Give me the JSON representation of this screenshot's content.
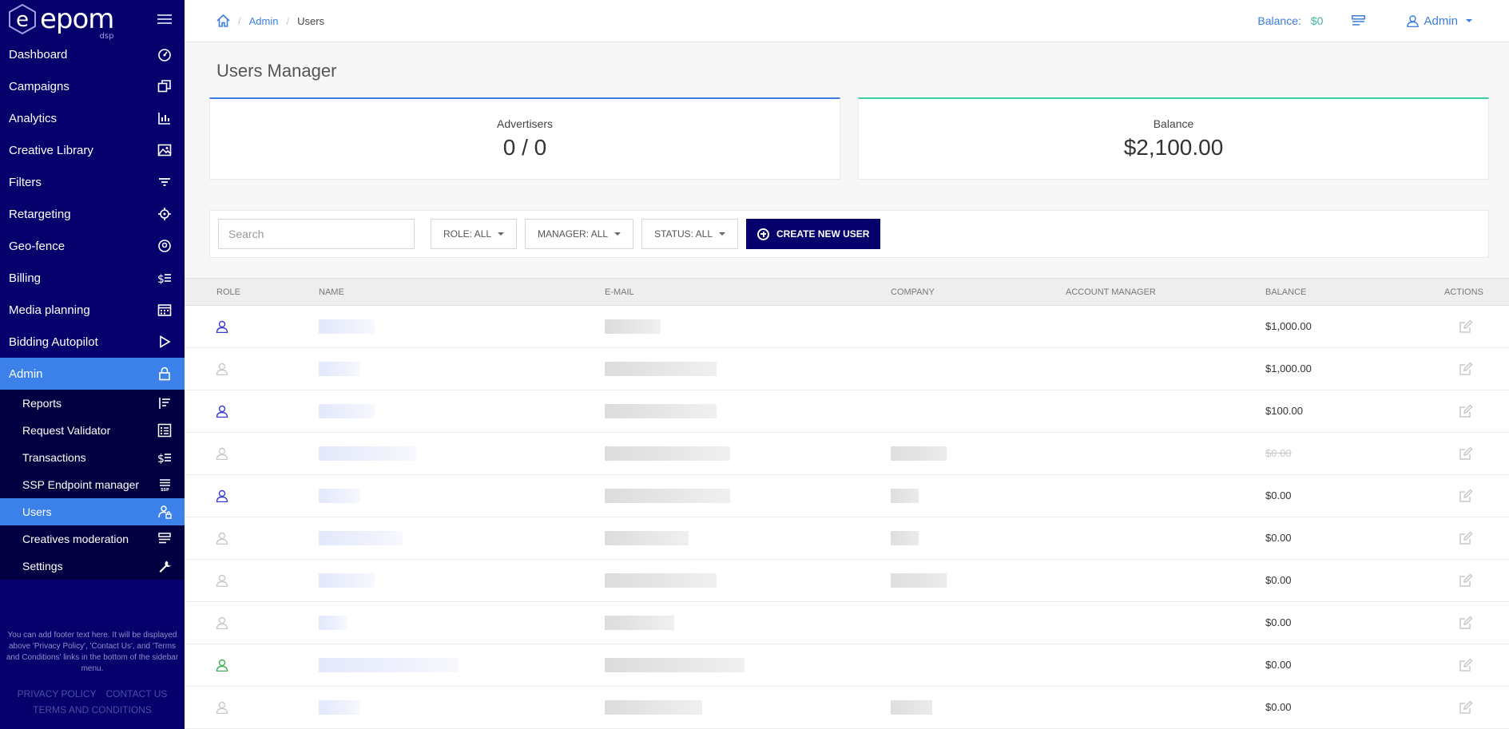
{
  "app": {
    "logo_text": "epom",
    "logo_sub": "dsp"
  },
  "sidebar": {
    "items": [
      {
        "label": "Dashboard",
        "icon": "dashboard-gauge-icon",
        "active": false
      },
      {
        "label": "Campaigns",
        "icon": "campaigns-squares-icon",
        "active": false
      },
      {
        "label": "Analytics",
        "icon": "analytics-bars-icon",
        "active": false
      },
      {
        "label": "Creative Library",
        "icon": "image-icon",
        "active": false
      },
      {
        "label": "Filters",
        "icon": "filter-lines-icon",
        "active": false
      },
      {
        "label": "Retargeting",
        "icon": "crosshair-icon",
        "active": false
      },
      {
        "label": "Geo-fence",
        "icon": "location-pin-icon",
        "active": false
      },
      {
        "label": "Billing",
        "icon": "dollar-lines-icon",
        "active": false
      },
      {
        "label": "Media planning",
        "icon": "calendar-icon",
        "active": false
      },
      {
        "label": "Bidding Autopilot",
        "icon": "play-icon",
        "active": false
      },
      {
        "label": "Admin",
        "icon": "lock-icon",
        "active": true
      }
    ],
    "sub_items": [
      {
        "label": "Reports",
        "icon": "reports-list-icon",
        "active": false
      },
      {
        "label": "Request Validator",
        "icon": "validator-list-icon",
        "active": false
      },
      {
        "label": "Transactions",
        "icon": "dollar-lines-icon",
        "active": false
      },
      {
        "label": "SSP Endpoint manager",
        "icon": "ssp-list-icon",
        "active": false
      },
      {
        "label": "Users",
        "icon": "users-lock-icon",
        "active": true
      },
      {
        "label": "Creatives moderation",
        "icon": "moderation-lines-icon",
        "active": false
      },
      {
        "label": "Settings",
        "icon": "wrench-icon",
        "active": false
      }
    ],
    "footer_text": "You can add footer text here. It will be displayed above 'Privacy Policy', 'Contact Us', and 'Terms and Conditions' links in the bottom of the sidebar menu.",
    "footer_links": {
      "privacy": "PRIVACY POLICY",
      "contact": "CONTACT US",
      "terms": "TERMS AND CONDITIONS"
    }
  },
  "topbar": {
    "breadcrumb": {
      "home_icon": "home-icon",
      "admin": "Admin",
      "current": "Users"
    },
    "balance_label": "Balance:",
    "balance_value": "$0",
    "admin_label": "Admin"
  },
  "page": {
    "title": "Users Manager",
    "cards": {
      "advertisers_label": "Advertisers",
      "advertisers_value": "0 / 0",
      "balance_label": "Balance",
      "balance_value": "$2,100.00"
    },
    "filters": {
      "search_placeholder": "Search",
      "role": "ROLE: ALL",
      "manager": "MANAGER: ALL",
      "status": "STATUS: ALL",
      "create_button": "CREATE NEW USER"
    }
  },
  "table": {
    "headers": {
      "role": "ROLE",
      "name": "NAME",
      "email": "E-MAIL",
      "company": "COMPANY",
      "account_manager": "ACCOUNT MANAGER",
      "balance": "BALANCE",
      "actions": "ACTIONS"
    },
    "role_colors": {
      "blue": "#3b3bcf",
      "gray": "#c8c8c8",
      "green": "#3fae55"
    },
    "rows": [
      {
        "role": "blue",
        "balance": "$1,000.00",
        "strike": false
      },
      {
        "role": "gray",
        "balance": "$1,000.00",
        "strike": false
      },
      {
        "role": "blue",
        "balance": "$100.00",
        "strike": false
      },
      {
        "role": "gray",
        "balance": "$0.00",
        "strike": true
      },
      {
        "role": "blue",
        "balance": "$0.00",
        "strike": false
      },
      {
        "role": "gray",
        "balance": "$0.00",
        "strike": false
      },
      {
        "role": "gray",
        "balance": "$0.00",
        "strike": false
      },
      {
        "role": "gray",
        "balance": "$0.00",
        "strike": false
      },
      {
        "role": "green",
        "balance": "$0.00",
        "strike": false
      },
      {
        "role": "gray",
        "balance": "$0.00",
        "strike": false
      }
    ]
  }
}
